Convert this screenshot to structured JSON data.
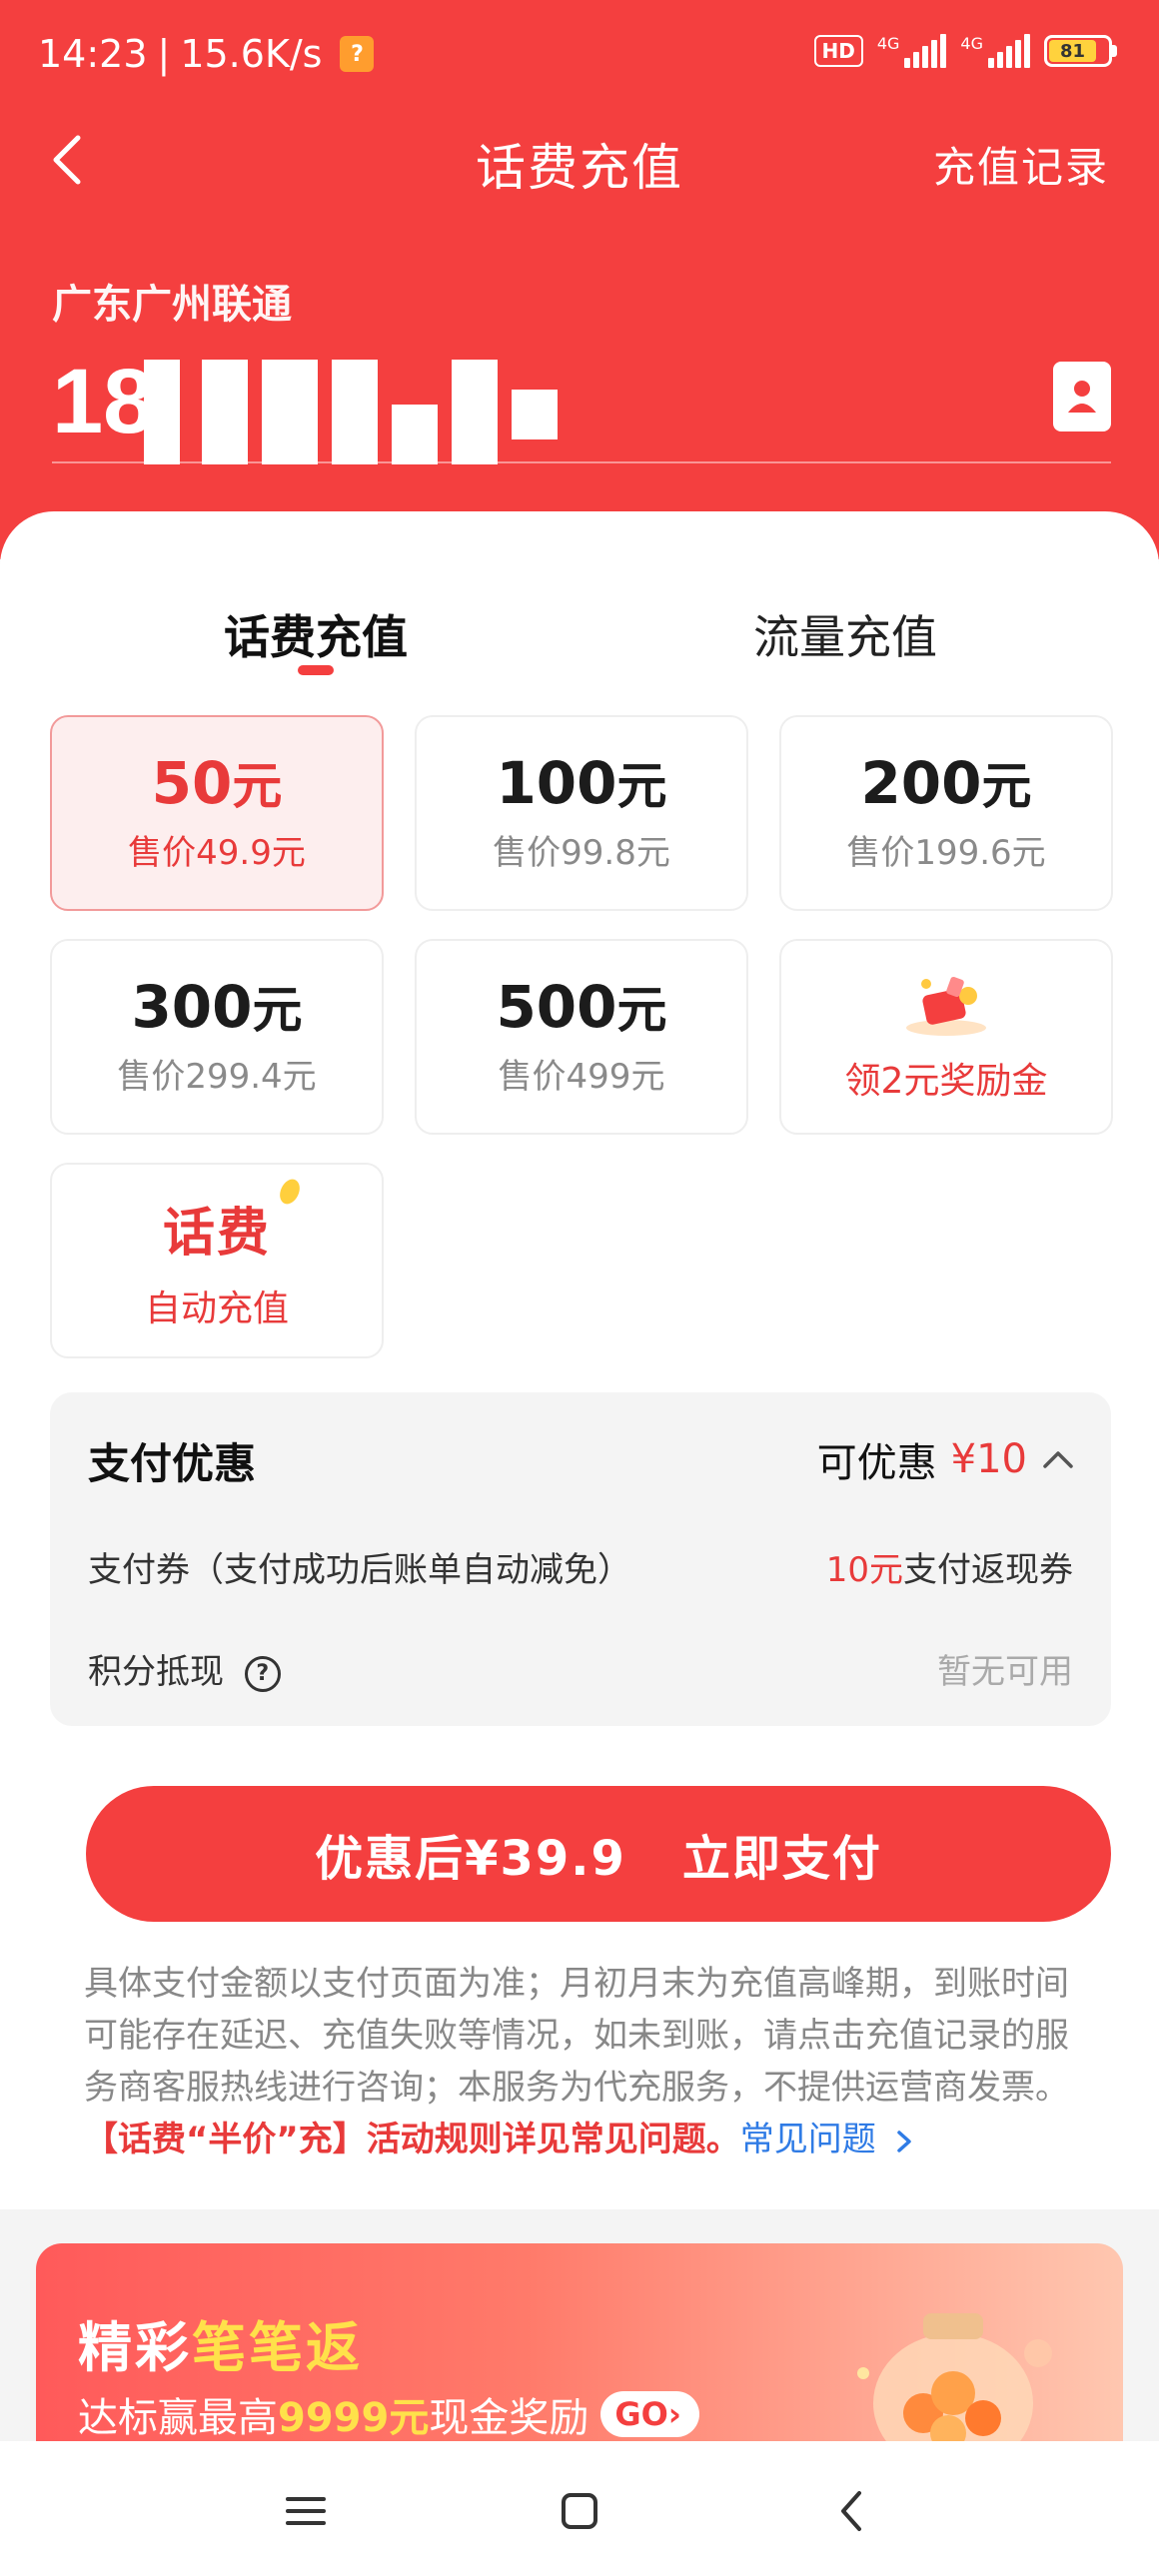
{
  "status_bar": {
    "time": "14:23",
    "net_speed": "15.6K/s",
    "hd_label": "HD",
    "net_type_1": "4G",
    "net_type_2": "4G",
    "battery": "81"
  },
  "nav": {
    "title": "话费充值",
    "record_link": "充值记录"
  },
  "account": {
    "carrier": "广东广州联通",
    "phone_prefix": "18"
  },
  "tabs": [
    {
      "label": "话费充值",
      "active": true
    },
    {
      "label": "流量充值",
      "active": false
    }
  ],
  "options": [
    {
      "amount": "50",
      "unit": "元",
      "price": "售价49.9元",
      "selected": true
    },
    {
      "amount": "100",
      "unit": "元",
      "price": "售价99.8元"
    },
    {
      "amount": "200",
      "unit": "元",
      "price": "售价199.6元"
    },
    {
      "amount": "300",
      "unit": "元",
      "price": "售价299.4元"
    },
    {
      "amount": "500",
      "unit": "元",
      "price": "售价499元"
    }
  ],
  "bonus_card": {
    "label": "领2元奖励金"
  },
  "auto_card": {
    "title": "话费",
    "subtitle": "自动充值"
  },
  "discount": {
    "title": "支付优惠",
    "available_label": "可优惠",
    "available_amount": "¥10",
    "coupon_label": "支付券（支付成功后账单自动减免）",
    "coupon_value_red": "10元",
    "coupon_value": "支付返现券",
    "points_label": "积分抵现",
    "points_value": "暂无可用"
  },
  "pay_button": {
    "price_label": "优惠后¥39.9",
    "action_label": "立即支付"
  },
  "notice": {
    "text": "具体支付金额以支付页面为准；月初月末为充值高峰期，到账时间可能存在延迟、充值失败等情况，如未到账，请点击充值记录的服务商客服热线进行咨询；本服务为代充服务，不提供运营商发票。",
    "highlight": "【话费“半价”充】活动规则详见常见问题。",
    "faq_link": "常见问题"
  },
  "banner": {
    "title_part1": "精彩",
    "title_part2": "笔笔返",
    "sub_part1": "达标赢最高",
    "sub_amount": "9999元",
    "sub_part2": "现金奖励",
    "go_label": "GO"
  },
  "colors": {
    "primary_red": "#f43f3f",
    "text_red": "#e83a3a",
    "link_blue": "#2f7be5",
    "highlight_yellow": "#ffe14a"
  }
}
